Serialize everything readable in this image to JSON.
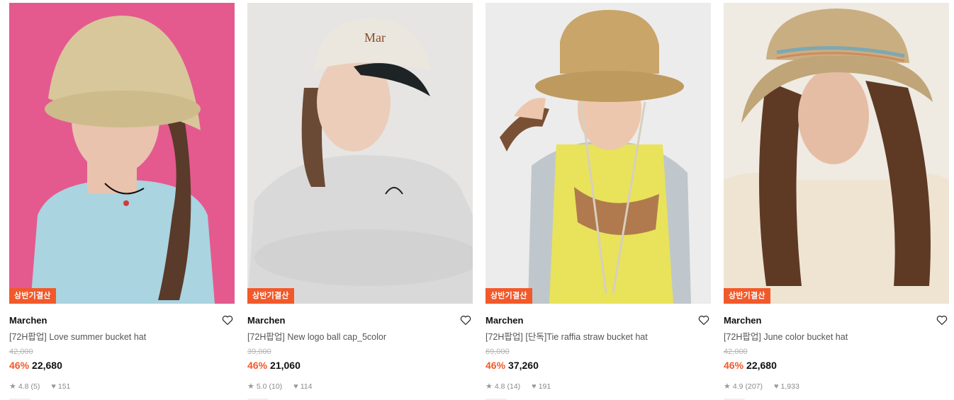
{
  "products": [
    {
      "badge": "상반기결산",
      "brand": "Marchen",
      "name": "[72H팝업] Love summer bucket hat",
      "original_price": "42,000",
      "discount": "46%",
      "price": "22,680",
      "rating": "4.8",
      "reviews": "(5)",
      "likes": "151",
      "colors": {
        "bg": "#e45a8f",
        "hat": "#d8c79a",
        "hair": "#5a3a2a",
        "top": "#a9d4e0",
        "skin": "#e9c3ae"
      }
    },
    {
      "badge": "상반기결산",
      "brand": "Marchen",
      "name": "[72H팝업] New logo ball cap_5color",
      "original_price": "39,000",
      "discount": "46%",
      "price": "21,060",
      "rating": "5.0",
      "reviews": "(10)",
      "likes": "114",
      "colors": {
        "bg": "#e6e5e3",
        "hat": "#ece7de",
        "hair": "#6b4a35",
        "top": "#d9d9d9",
        "skin": "#eccdb9"
      }
    },
    {
      "badge": "상반기결산",
      "brand": "Marchen",
      "name": "[72H팝업] [단독]Tie raffia straw bucket hat",
      "original_price": "69,000",
      "discount": "46%",
      "price": "37,260",
      "rating": "4.8",
      "reviews": "(14)",
      "likes": "191",
      "colors": {
        "bg": "#ececec",
        "hat": "#c9a56a",
        "hair": "#7a5035",
        "top": "#e8e35a",
        "skin": "#ecc7ae"
      }
    },
    {
      "badge": "상반기결산",
      "brand": "Marchen",
      "name": "[72H팝업] June color bucket hat",
      "original_price": "42,000",
      "discount": "46%",
      "price": "22,680",
      "rating": "4.9",
      "reviews": "(207)",
      "likes": "1,933",
      "colors": {
        "bg": "#efeae2",
        "hat": "#c9ae82",
        "hair": "#5e3a25",
        "top": "#efe4d2",
        "skin": "#e5bda4"
      }
    }
  ]
}
